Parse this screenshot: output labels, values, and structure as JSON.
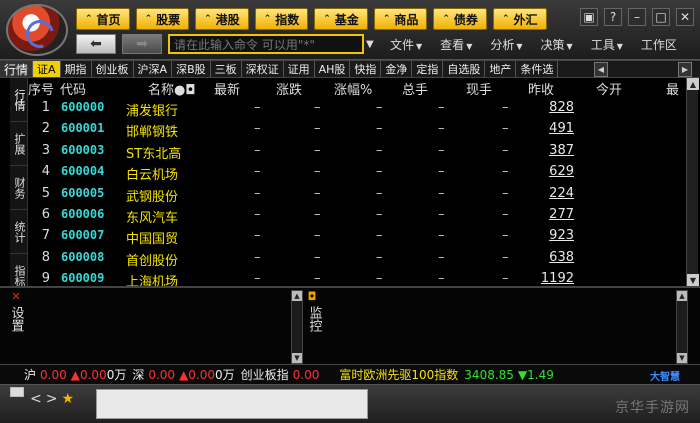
{
  "nav": {
    "buttons": [
      "首页",
      "股票",
      "港股",
      "指数",
      "基金",
      "商品",
      "债券",
      "外汇"
    ]
  },
  "toolbar": {
    "back_icon": "back-arrow-icon",
    "forward_icon": "forward-arrow-icon",
    "command_placeholder": "请在此输入命令  可以用\"*\"",
    "menus": [
      "文件",
      "查看",
      "分析",
      "决策",
      "工具",
      "工作区"
    ]
  },
  "tabs": {
    "first": "行情",
    "items": [
      "证A",
      "期指",
      "创业板",
      "沪深A",
      "深B股",
      "三板",
      "深权证",
      "证用",
      "AH股",
      "快指",
      "金净",
      "定指",
      "自选股",
      "地产",
      "条件选"
    ]
  },
  "side_tabs": [
    "行情",
    "扩展",
    "财务",
    "统计",
    "指标"
  ],
  "table": {
    "headers": [
      "序号",
      "代码",
      "名称●◘",
      "最新",
      "涨跌",
      "涨幅%",
      "总手",
      "现手",
      "昨收",
      "今开",
      "最"
    ],
    "rows": [
      {
        "seq": "1",
        "code": "600000",
        "name": "浦发银行",
        "prevclose": "828"
      },
      {
        "seq": "2",
        "code": "600001",
        "name": "邯郸钢铁",
        "prevclose": "491"
      },
      {
        "seq": "3",
        "code": "600003",
        "name": "ST东北高",
        "prevclose": "387"
      },
      {
        "seq": "4",
        "code": "600004",
        "name": "白云机场",
        "prevclose": "629"
      },
      {
        "seq": "5",
        "code": "600005",
        "name": "武钢股份",
        "prevclose": "224"
      },
      {
        "seq": "6",
        "code": "600006",
        "name": "东风汽车",
        "prevclose": "277"
      },
      {
        "seq": "7",
        "code": "600007",
        "name": "中国国贸",
        "prevclose": "923"
      },
      {
        "seq": "8",
        "code": "600008",
        "name": "首创股份",
        "prevclose": "638"
      },
      {
        "seq": "9",
        "code": "600009",
        "name": "上海机场",
        "prevclose": "1192"
      }
    ],
    "dash": "–"
  },
  "bottom": {
    "left_label": "设置",
    "right_label": "监控"
  },
  "status": {
    "sh_label": "沪",
    "sh_value": "0.00",
    "sh_change": "▲0.00",
    "sh_volume": "0万",
    "sz_label": "深",
    "sz_value": "0.00",
    "sz_change": "▲0.00",
    "sz_volume": "0万",
    "cyb_label": "创业板指",
    "cyb_value": "0.00",
    "ftse_label": "富时欧洲先驱100指数",
    "ftse_value": "3408.85",
    "ftse_change": "▼1.49",
    "brand": "大智慧"
  },
  "footer": {
    "nav_left": "<",
    "nav_right": ">",
    "star": "★",
    "watermark": "京华手游网"
  },
  "colors": {
    "accent_yellow": "#f4e300",
    "code_cyan": "#38d8d8",
    "up_red": "#ff3030",
    "down_green": "#30e030"
  }
}
